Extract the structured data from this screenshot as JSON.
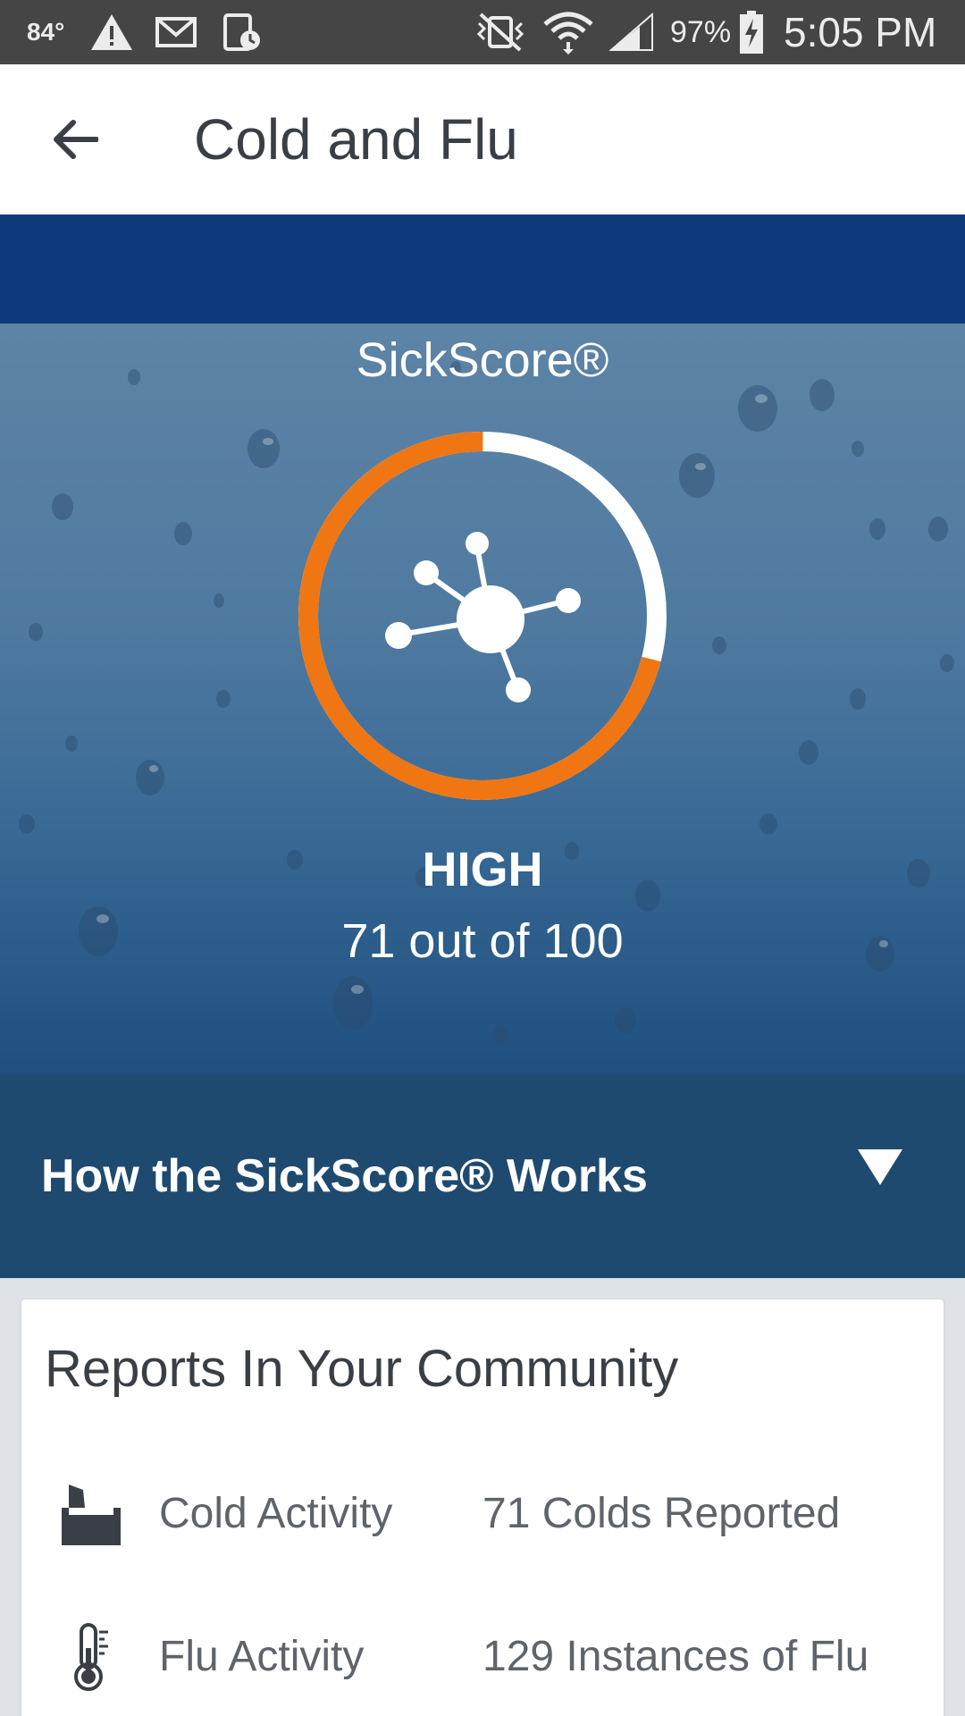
{
  "status_bar": {
    "temperature": "84°",
    "battery": "97%",
    "time": "5:05 PM"
  },
  "app_bar": {
    "title": "Cold and Flu"
  },
  "hero": {
    "label": "SickScore®",
    "level": "HIGH",
    "score_text": "71 out of 100",
    "score": 71,
    "max": 100
  },
  "how_works": {
    "label": "How the SickScore® Works"
  },
  "reports": {
    "title": "Reports In Your Community",
    "rows": [
      {
        "icon": "tissue-box-icon",
        "label": "Cold Activity",
        "value": "71 Colds Reported"
      },
      {
        "icon": "thermometer-icon",
        "label": "Flu Activity",
        "value": "129 Instances of Flu"
      }
    ]
  },
  "colors": {
    "gauge_accent": "#f07613",
    "navy": "#0f3a7b",
    "how_works_bg": "#1f4a70"
  }
}
